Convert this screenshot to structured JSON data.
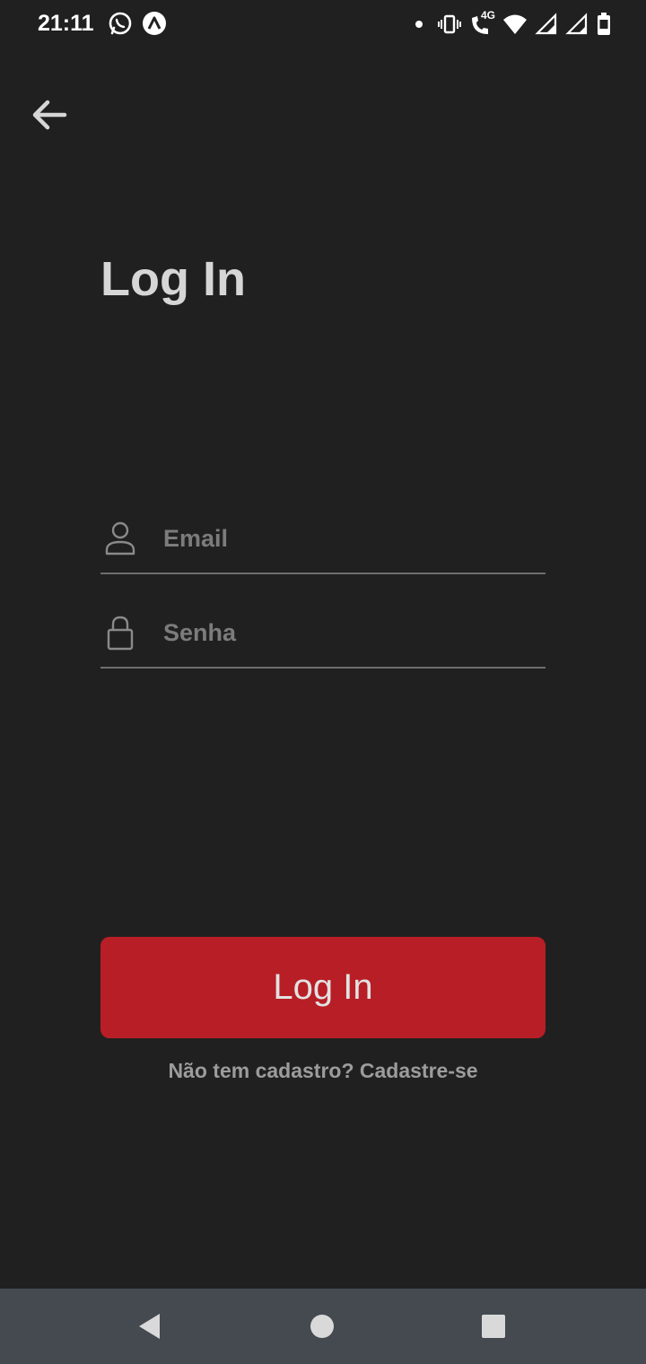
{
  "status_bar": {
    "time": "21:11",
    "icons": [
      "whatsapp-icon",
      "app-notification-icon",
      "dot-icon",
      "vibrate-icon",
      "volte-4g-icon",
      "wifi-icon",
      "signal-icon",
      "signal-icon-2",
      "battery-icon"
    ],
    "network_label": "4G"
  },
  "header": {
    "back_icon": "arrow-left-icon"
  },
  "main": {
    "title": "Log In",
    "email_field": {
      "placeholder": "Email",
      "value": "",
      "icon": "user-icon"
    },
    "password_field": {
      "placeholder": "Senha",
      "value": "",
      "icon": "lock-icon"
    },
    "login_button_label": "Log In",
    "signup_link": "Não tem cadastro? Cadastre-se"
  },
  "colors": {
    "background": "#212020",
    "accent": "#b81e26",
    "nav_bar": "#454a51"
  },
  "nav_bar": {
    "back_icon": "triangle-back-icon",
    "home_icon": "circle-home-icon",
    "recents_icon": "square-recents-icon"
  }
}
